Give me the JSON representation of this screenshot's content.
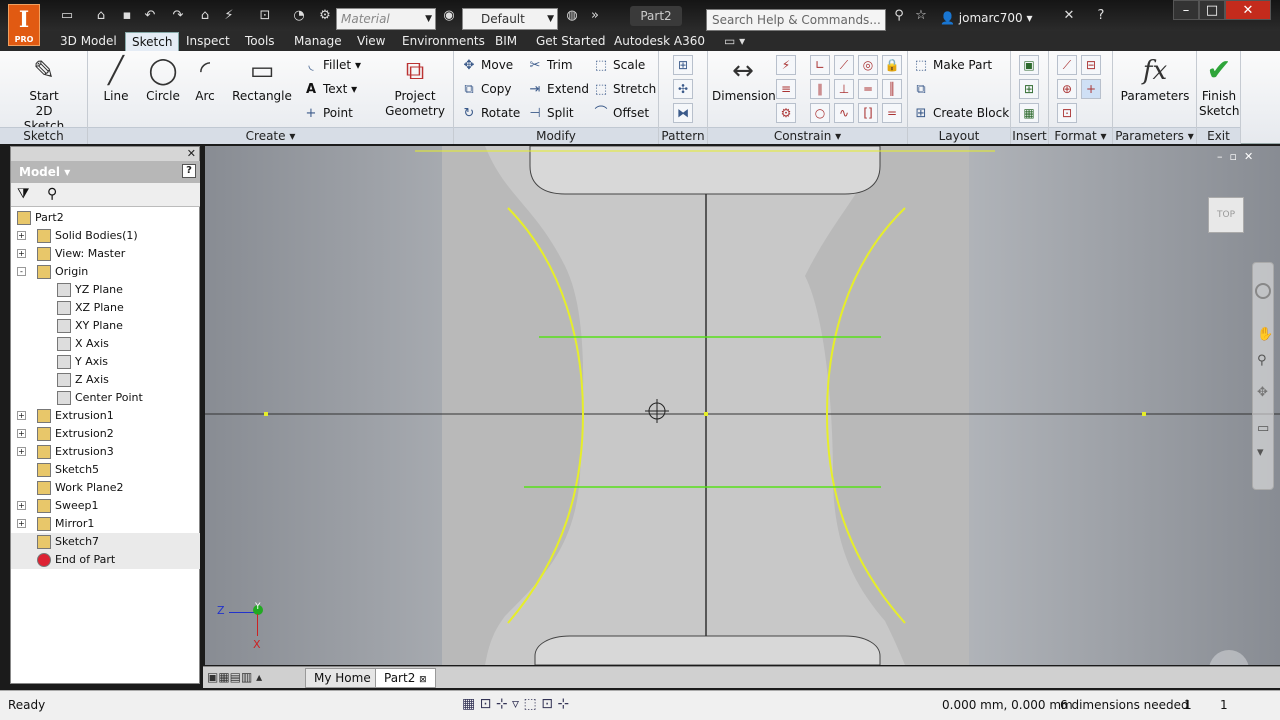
{
  "titlebar": {
    "logo": "I",
    "logo_sub": "PRO",
    "material": "Material",
    "appearance": "Default",
    "doc_title": "Part2",
    "search_placeholder": "Search Help & Commands...",
    "user": "jomarc700"
  },
  "tabs": [
    "3D Model",
    "Sketch",
    "Inspect",
    "Tools",
    "Manage",
    "View",
    "Environments",
    "BIM",
    "Get Started",
    "Autodesk A360"
  ],
  "active_tab": "Sketch",
  "ribbon": {
    "sketch_panel": {
      "start": "Start",
      "start2": "2D Sketch",
      "footer": "Sketch"
    },
    "create_panel": {
      "line": "Line",
      "circle": "Circle",
      "arc": "Arc",
      "rectangle": "Rectangle",
      "fillet": "Fillet",
      "text": "Text",
      "point": "Point",
      "project": "Project",
      "project2": "Geometry",
      "footer": "Create"
    },
    "modify_panel": {
      "move": "Move",
      "copy": "Copy",
      "rotate": "Rotate",
      "trim": "Trim",
      "extend": "Extend",
      "split": "Split",
      "scale": "Scale",
      "stretch": "Stretch",
      "offset": "Offset",
      "footer": "Modify"
    },
    "pattern_panel": {
      "footer": "Pattern"
    },
    "constrain_panel": {
      "dimension": "Dimension",
      "footer": "Constrain"
    },
    "layout_panel": {
      "make_part": "Make Part",
      "create_block": "Create Block",
      "footer": "Layout"
    },
    "insert_panel": {
      "footer": "Insert"
    },
    "format_panel": {
      "footer": "Format"
    },
    "parameters_panel": {
      "parameters": "Parameters",
      "footer": "Parameters"
    },
    "exit_panel": {
      "finish": "Finish",
      "finish2": "Sketch",
      "footer": "Exit"
    }
  },
  "browser": {
    "title": "Model",
    "items": [
      {
        "label": "Part2",
        "level": 0,
        "exp": ""
      },
      {
        "label": "Solid Bodies(1)",
        "level": 1,
        "exp": "+"
      },
      {
        "label": "View: Master",
        "level": 1,
        "exp": "+"
      },
      {
        "label": "Origin",
        "level": 1,
        "exp": "-"
      },
      {
        "label": "YZ Plane",
        "level": 2,
        "exp": ""
      },
      {
        "label": "XZ Plane",
        "level": 2,
        "exp": ""
      },
      {
        "label": "XY Plane",
        "level": 2,
        "exp": ""
      },
      {
        "label": "X Axis",
        "level": 2,
        "exp": ""
      },
      {
        "label": "Y Axis",
        "level": 2,
        "exp": ""
      },
      {
        "label": "Z Axis",
        "level": 2,
        "exp": ""
      },
      {
        "label": "Center Point",
        "level": 2,
        "exp": ""
      },
      {
        "label": "Extrusion1",
        "level": 1,
        "exp": "+"
      },
      {
        "label": "Extrusion2",
        "level": 1,
        "exp": "+"
      },
      {
        "label": "Extrusion3",
        "level": 1,
        "exp": "+"
      },
      {
        "label": "Sketch5",
        "level": 1,
        "exp": ""
      },
      {
        "label": "Work Plane2",
        "level": 1,
        "exp": ""
      },
      {
        "label": "Sweep1",
        "level": 1,
        "exp": "+"
      },
      {
        "label": "Mirror1",
        "level": 1,
        "exp": "+"
      },
      {
        "label": "Sketch7",
        "level": 1,
        "exp": ""
      },
      {
        "label": "End of Part",
        "level": 1,
        "exp": ""
      }
    ]
  },
  "viewcube": {
    "label": "TOP"
  },
  "triad": {
    "z": "Z",
    "y": "Y",
    "x": "X"
  },
  "doctabs": {
    "home": "My Home",
    "part": "Part2"
  },
  "status": {
    "ready": "Ready",
    "coords": "0.000 mm, 0.000 mm",
    "dims": "6 dimensions needed",
    "n1": "1",
    "n2": "1"
  },
  "colors": {
    "sketch_yellow": "#e6ee2a",
    "sketch_green": "#58e01a",
    "active_tab": "#e5ecf5"
  }
}
